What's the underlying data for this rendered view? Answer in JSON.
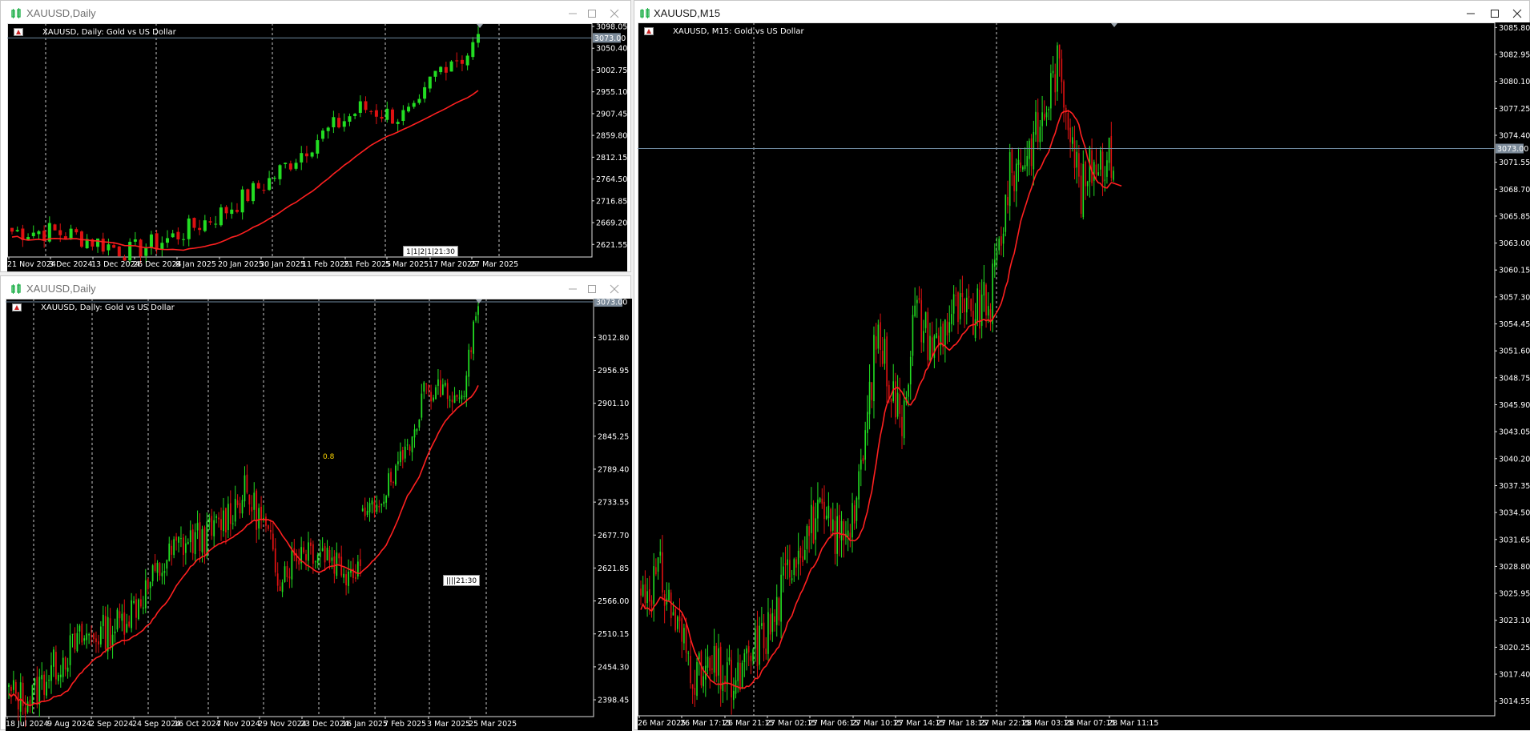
{
  "windows": [
    {
      "id": "w1",
      "title": "XAUUSD,Daily",
      "active": false,
      "chart_label": "XAUUSD, Daily:  Gold vs US Dollar",
      "price_ticks": [
        "3098.05",
        "3050.40",
        "3002.75",
        "2955.10",
        "2907.45",
        "2859.80",
        "2812.15",
        "2764.50",
        "2716.85",
        "2669.20",
        "2621.55"
      ],
      "price_min": 2594.0,
      "price_max": 3098.05,
      "current_price": "3073.00",
      "date_ticks": [
        "21 Nov 2024",
        "3 Dec 2024",
        "13 Dec 2024",
        "26 Dec 2024",
        "8 Jan 2025",
        "20 Jan 2025",
        "30 Jan 2025",
        "11 Feb 2025",
        "21 Feb 2025",
        "5 Mar 2025",
        "17 Mar 2025",
        "27 Mar 2025"
      ],
      "marker": "1|1|2|1|21:30"
    },
    {
      "id": "w2",
      "title": "XAUUSD,Daily",
      "active": false,
      "chart_label": "XAUUSD, Daily:  Gold vs US Dollar",
      "price_ticks": [
        "3012.80",
        "2956.95",
        "2901.10",
        "2845.25",
        "2789.40",
        "2733.55",
        "2677.70",
        "2621.85",
        "2566.00",
        "2510.15",
        "2454.30",
        "2398.45"
      ],
      "price_min": 2370.0,
      "price_max": 3073.0,
      "current_price": "3073.00",
      "date_ticks": [
        "18 Jul 2024",
        "9 Aug 2024",
        "2 Sep 2024",
        "24 Sep 2024",
        "16 Oct 2024",
        "7 Nov 2024",
        "29 Nov 2024",
        "23 Dec 2024",
        "16 Jan 2025",
        "7 Feb 2025",
        "3 Mar 2025",
        "25 Mar 2025"
      ],
      "marker": "||||21:30",
      "annotation": "0.8"
    },
    {
      "id": "w3",
      "title": "XAUUSD,M15",
      "active": true,
      "chart_label": "XAUUSD, M15:  Gold vs US Dollar",
      "price_ticks": [
        "3085.80",
        "3082.95",
        "3080.10",
        "3077.25",
        "3074.40",
        "3071.55",
        "3068.70",
        "3065.85",
        "3063.00",
        "3060.15",
        "3057.30",
        "3054.45",
        "3051.60",
        "3048.75",
        "3045.90",
        "3043.05",
        "3040.20",
        "3037.35",
        "3034.50",
        "3031.65",
        "3028.80",
        "3025.95",
        "3023.10",
        "3020.25",
        "3017.40",
        "3014.55"
      ],
      "price_min": 3013.0,
      "price_max": 3086.0,
      "current_price": "3073.00",
      "date_ticks": [
        "26 Mar 2025",
        "26 Mar 17:15",
        "26 Mar 21:15",
        "27 Mar 02:15",
        "27 Mar 06:15",
        "27 Mar 10:15",
        "27 Mar 14:15",
        "27 Mar 18:15",
        "27 Mar 22:15",
        "28 Mar 03:15",
        "28 Mar 07:15",
        "28 Mar 11:15"
      ]
    }
  ],
  "colors": {
    "bull": "#22dd22",
    "bear": "#dd1111",
    "ma": "#ff2020",
    "grid": "#c8c8c8",
    "axis_text": "#ffffff",
    "price_line": "#6f8aa0",
    "title_icon": "#22b14c"
  }
}
